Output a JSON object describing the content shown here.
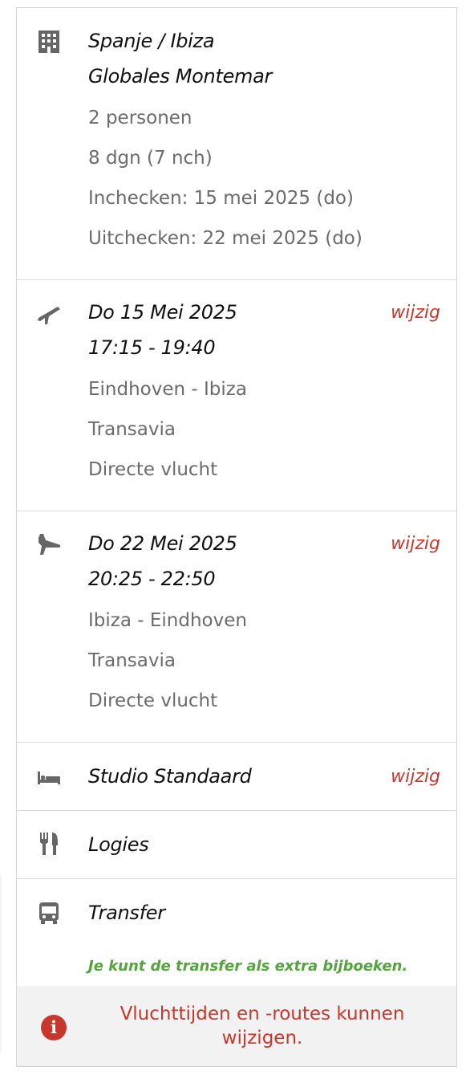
{
  "colors": {
    "accent_red": "#c8372d",
    "upsell_green": "#53a43d",
    "icon_gray": "#666666",
    "border": "#d9d9d9"
  },
  "accommodation": {
    "icon": "building-icon",
    "destination": "Spanje / Ibiza",
    "hotel": "Globales Montemar",
    "persons": "2 personen",
    "duration": "8 dgn (7 nch)",
    "checkin": "Inchecken: 15 mei 2025 (do)",
    "checkout": "Uitchecken: 22 mei 2025 (do)"
  },
  "outbound_flight": {
    "icon": "plane-departure-icon",
    "date": "Do 15 Mei 2025",
    "times": "17:15 - 19:40",
    "route": "Eindhoven - Ibiza",
    "carrier": "Transavia",
    "type": "Directe vlucht",
    "edit_label": "wijzig"
  },
  "return_flight": {
    "icon": "plane-arrival-icon",
    "date": "Do 22 Mei 2025",
    "times": "20:25 - 22:50",
    "route": "Ibiza - Eindhoven",
    "carrier": "Transavia",
    "type": "Directe vlucht",
    "edit_label": "wijzig"
  },
  "room": {
    "icon": "bed-icon",
    "label": "Studio Standaard",
    "edit_label": "wijzig"
  },
  "board": {
    "icon": "utensils-icon",
    "label": "Logies"
  },
  "transfer": {
    "icon": "bus-icon",
    "label": "Transfer",
    "upsell": "Je kunt de transfer als extra bijboeken."
  },
  "notice": {
    "icon": "info-icon",
    "text": "Vluchttijden en -routes kunnen wijzigen."
  }
}
